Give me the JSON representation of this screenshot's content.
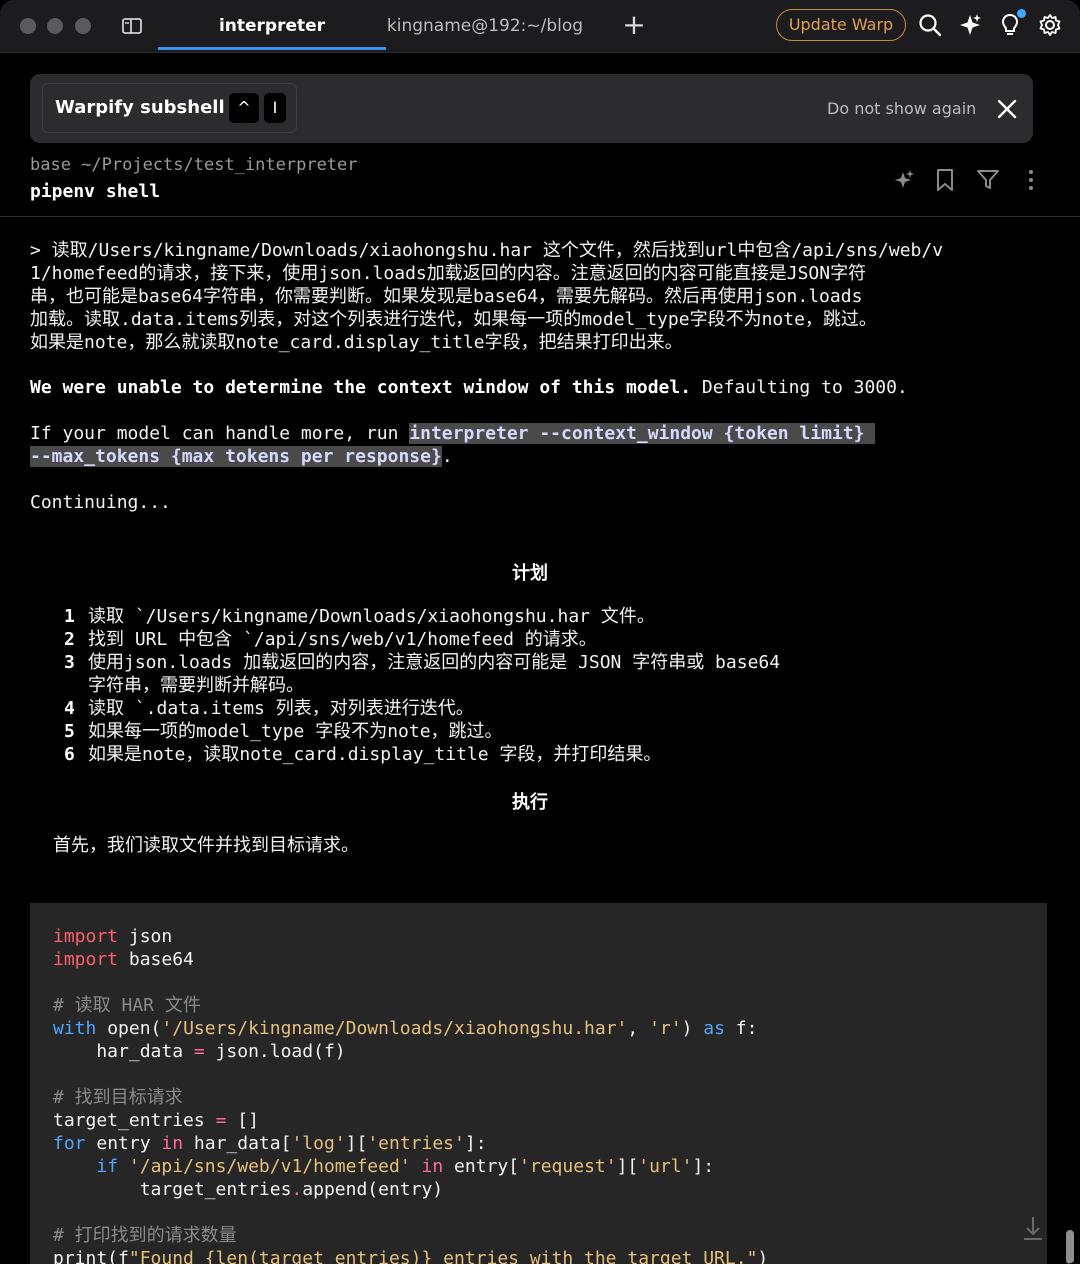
{
  "tabs": [
    {
      "label": "interpreter",
      "active": true
    },
    {
      "label": "kingname@192:~/blog",
      "active": false
    }
  ],
  "toolbar": {
    "update_label": "Update Warp",
    "icons": [
      "new-tab-icon",
      "search-icon",
      "sparkles-icon",
      "lightbulb-icon",
      "gear-icon"
    ],
    "accent": "#3d8ff0",
    "update_color": "#e0a04a",
    "notification_dot": "#3fa9ff"
  },
  "banner": {
    "title": "Warpify subshell",
    "keys": [
      "^",
      "I"
    ],
    "dismiss_label": "Do not show again"
  },
  "block": {
    "cwd": "base ~/Projects/test_interpreter",
    "command": "pipenv shell"
  },
  "prompt_lines": [
    "> 读取/Users/kingname/Downloads/xiaohongshu.har 这个文件，然后找到url中包含/api/sns/web/v",
    "1/homefeed的请求，接下来，使用json.loads加载返回的内容。注意返回的内容可能直接是JSON字符",
    "串，也可能是base64字符串，你需要判断。如果发现是base64，需要先解码。然后再使用json.loads",
    "加载。读取.data.items列表，对这个列表进行迭代，如果每一项的model_type字段不为note，跳过。",
    "如果是note，那么就读取note_card.display_title字段，把结果打印出来。"
  ],
  "warning": {
    "bold": "We were unable to determine the context window of this model.",
    "rest": " Defaulting to 3000."
  },
  "hint": {
    "prefix": "If your model can handle more, run ",
    "cmd1": "interpreter --context_window {token limit} ",
    "cmd2": "--max_tokens {max tokens per response}",
    "suffix": "."
  },
  "continuing": "Continuing...",
  "plan": {
    "heading": "计划",
    "items": [
      {
        "num": "1",
        "lines": [
          "读取 `/Users/kingname/Downloads/xiaohongshu.har 文件。"
        ]
      },
      {
        "num": "2",
        "lines": [
          "找到 URL 中包含 `/api/sns/web/v1/homefeed 的请求。"
        ]
      },
      {
        "num": "3",
        "lines": [
          "使用json.loads 加载返回的内容，注意返回的内容可能是 JSON 字符串或 base64",
          "字符串，需要判断并解码。"
        ]
      },
      {
        "num": "4",
        "lines": [
          "读取 `.data.items 列表，对列表进行迭代。"
        ]
      },
      {
        "num": "5",
        "lines": [
          "如果每一项的model_type 字段不为note，跳过。"
        ]
      },
      {
        "num": "6",
        "lines": [
          "如果是note，读取note_card.display_title 字段，并打印结果。"
        ]
      }
    ]
  },
  "execute": {
    "heading": "执行",
    "intro": "首先，我们读取文件并找到目标请求。"
  },
  "code": {
    "l1_kw": "import",
    "l1_rest": " json",
    "l2_kw": "import",
    "l2_rest": " base64",
    "l3_cmt": "# 读取 HAR 文件",
    "l4_kw": "with",
    "l4_a": " open(",
    "l4_s1": "'/Users/kingname/Downloads/xiaohongshu.har'",
    "l4_b": ", ",
    "l4_s2": "'r'",
    "l4_c": ") ",
    "l4_kw2": "as",
    "l4_d": " f:",
    "l5_a": "    har_data ",
    "l5_op": "=",
    "l5_b": " json.load(f)",
    "l6_cmt": "# 找到目标请求",
    "l7_a": "target_entries ",
    "l7_op": "=",
    "l7_b": " []",
    "l8_kw": "for",
    "l8_a": " entry ",
    "l8_kw2": "in",
    "l8_b": " har_data[",
    "l8_s1": "'log'",
    "l8_c": "][",
    "l8_s2": "'entries'",
    "l8_d": "]:",
    "l9_ind": "    ",
    "l9_kw": "if",
    "l9_a": " ",
    "l9_s1": "'/api/sns/web/v1/homefeed'",
    "l9_b": " ",
    "l9_kw2": "in",
    "l9_c": " entry[",
    "l9_s2": "'request'",
    "l9_d": "][",
    "l9_s3": "'url'",
    "l9_e": "]:",
    "l10_a": "        target_entries",
    "l10_op": ".",
    "l10_b": "append(entry)",
    "l11_cmt": "# 打印找到的请求数量",
    "l12_a": "print(f",
    "l12_s": "\"Found {len(target_entries)} entries with the target URL.\"",
    "l12_b": ")"
  }
}
